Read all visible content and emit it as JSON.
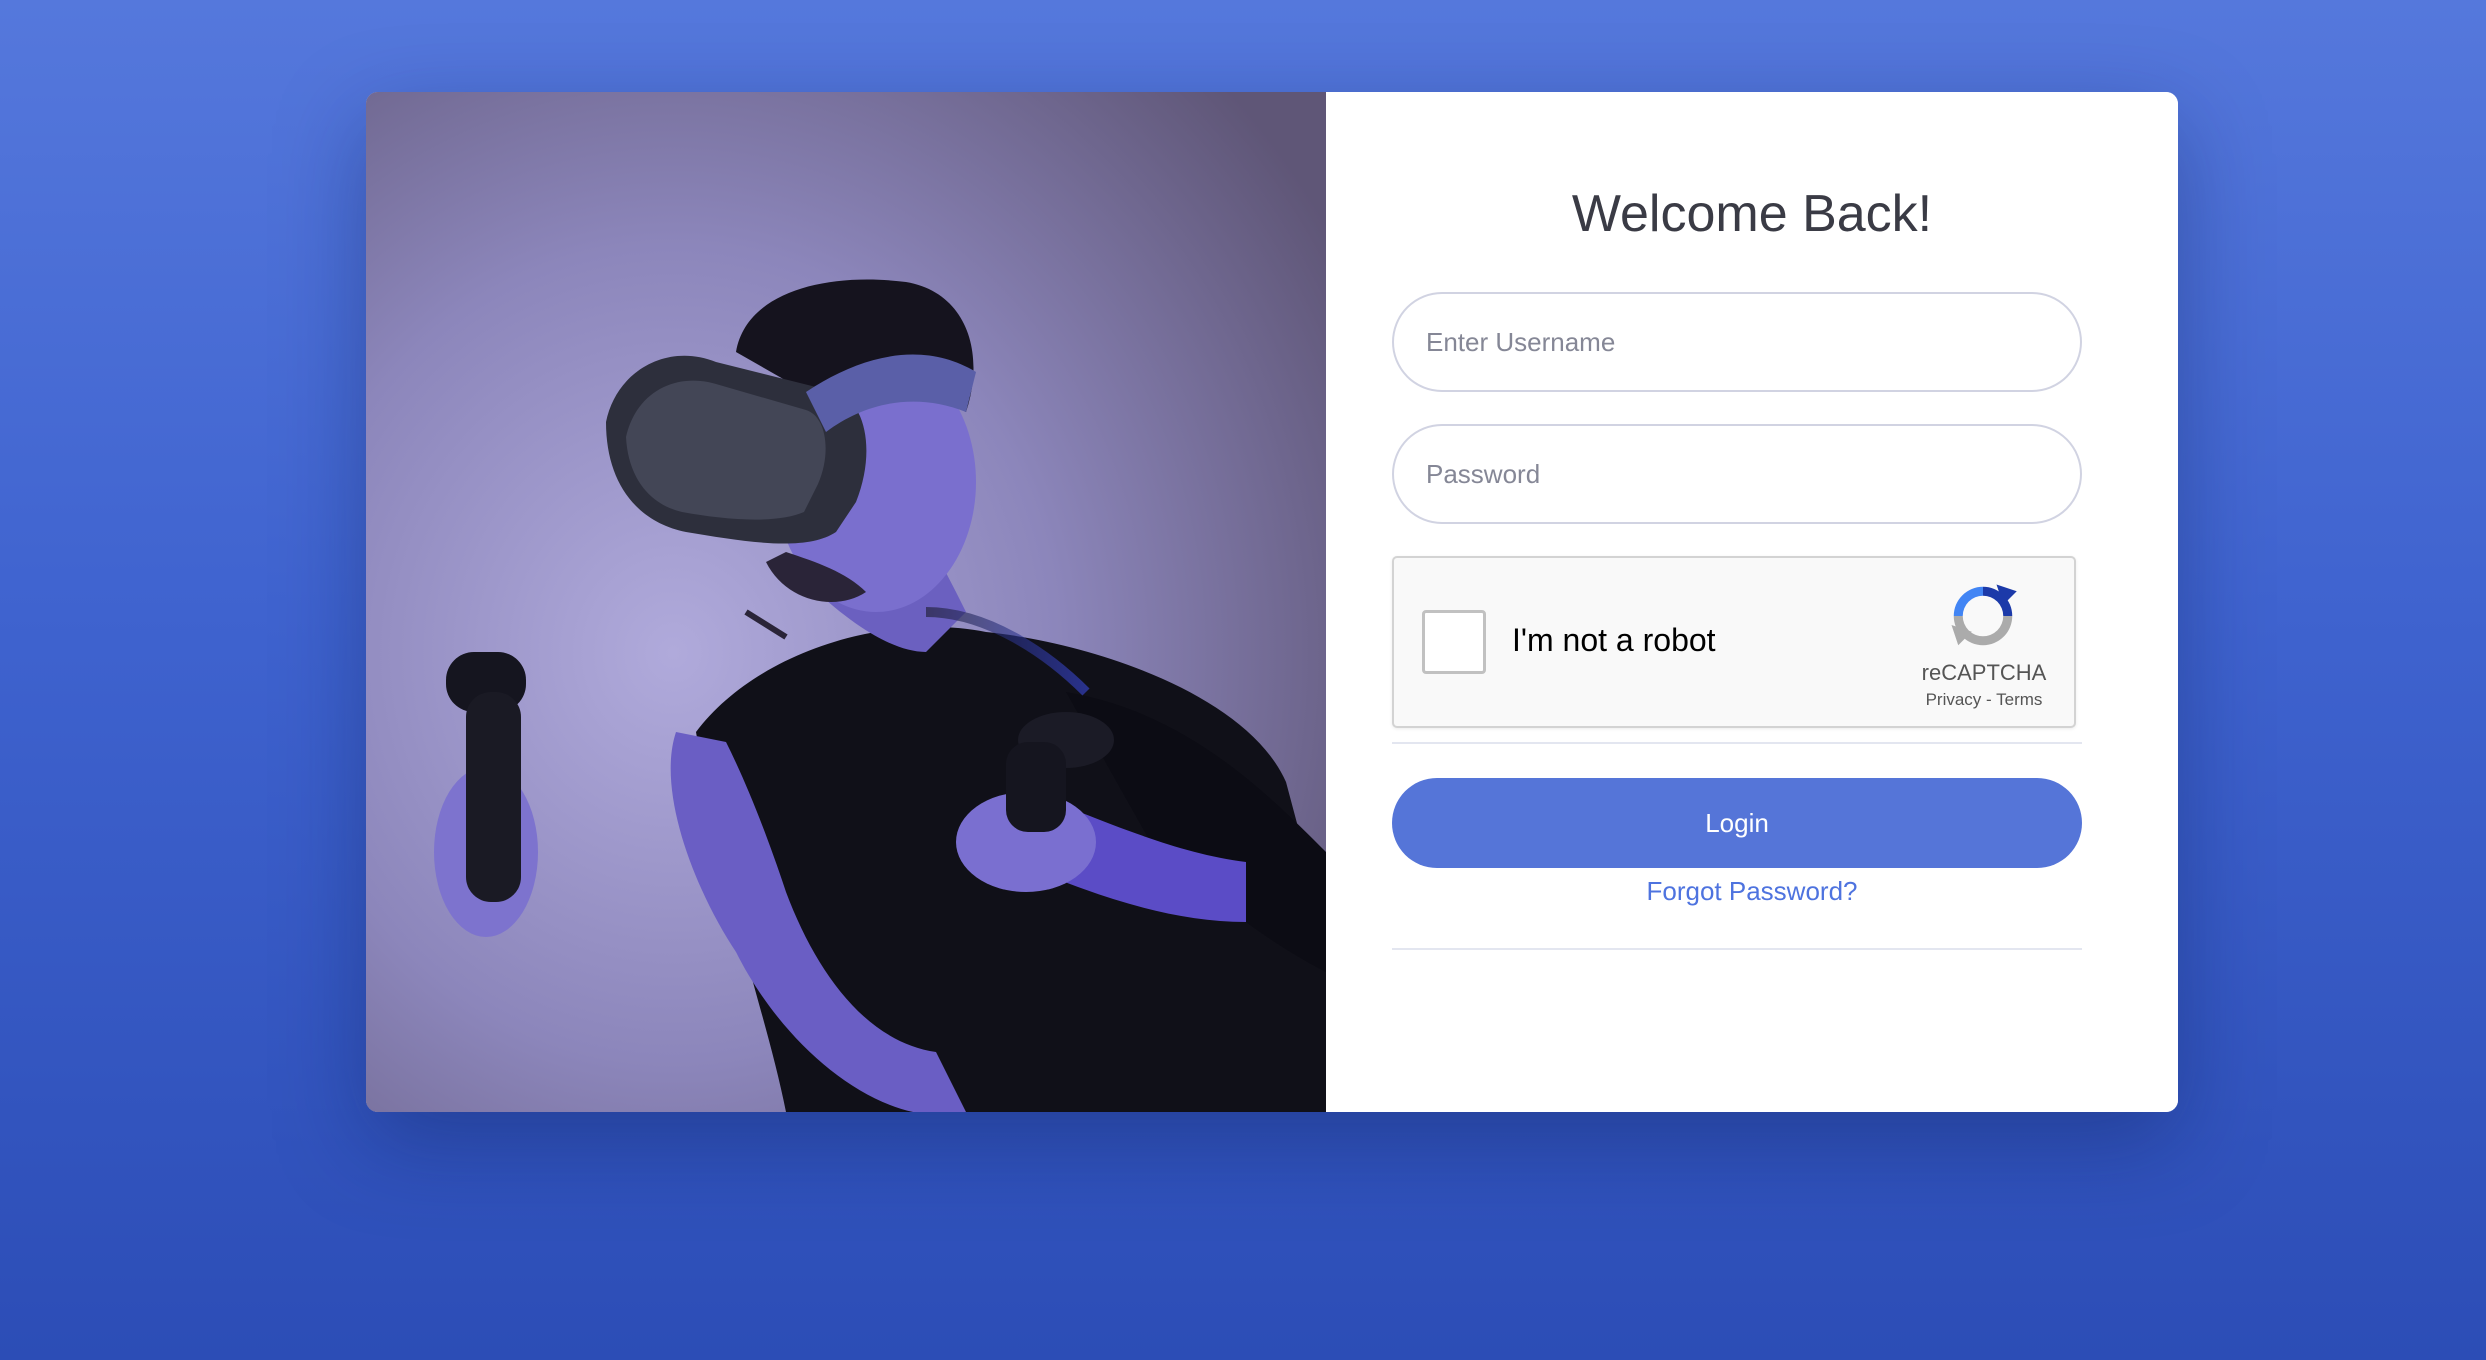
{
  "login": {
    "title": "Welcome Back!",
    "username_placeholder": "Enter Username",
    "password_placeholder": "Password",
    "login_label": "Login",
    "forgot_label": "Forgot Password?"
  },
  "recaptcha": {
    "label": "I'm not a robot",
    "brand": "reCAPTCHA",
    "privacy": "Privacy",
    "separator": " - ",
    "terms": "Terms",
    "icon": "recaptcha-logo-icon"
  },
  "colors": {
    "background": "#4668d4",
    "primary": "#5575d8",
    "link": "#4e73df",
    "title": "#3a3b45"
  }
}
